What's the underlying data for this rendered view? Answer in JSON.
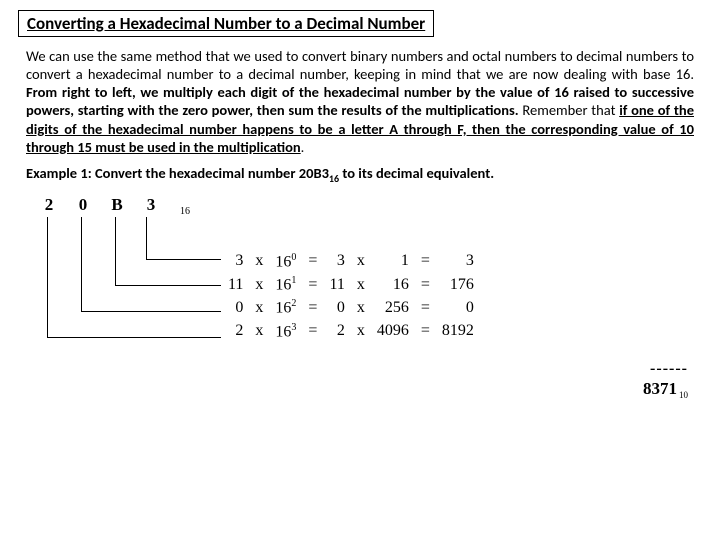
{
  "title": "Converting a Hexadecimal Number to a Decimal Number",
  "para": {
    "p1": "We can use the same method that we used to convert binary numbers and octal numbers to decimal numbers to convert a hexadecimal number to a decimal number, keeping in mind that we are now dealing with base 16. ",
    "p2": "From right to left, we multiply each digit of the hexadecimal number by the value of 16 raised to successive powers, starting with the zero power, then sum the results of the multiplications.",
    "p3": " Remember that ",
    "p4": "if one of the digits of the hexadecimal number happens to be a letter A through F, then the corresponding value of 10 through 15 must be used in the multiplication",
    "p5": "."
  },
  "example_label": "Example 1: Convert the hexadecimal number 20B3",
  "example_sub": "16",
  "example_tail": " to its decimal equivalent.",
  "hex": {
    "d0": "2",
    "d1": "0",
    "d2": "B",
    "d3": "3",
    "sub": "16"
  },
  "calc": {
    "rows": [
      {
        "v": "3",
        "p": "0",
        "a": "3",
        "b": "1",
        "r": "3"
      },
      {
        "v": "11",
        "p": "1",
        "a": "11",
        "b": "16",
        "r": "176"
      },
      {
        "v": "0",
        "p": "2",
        "a": "0",
        "b": "256",
        "r": "0"
      },
      {
        "v": "2",
        "p": "3",
        "a": "2",
        "b": "4096",
        "r": "8192"
      }
    ],
    "x": "x",
    "eq": "=",
    "base": "16"
  },
  "divider": "------",
  "answer": "8371",
  "answer_sub": "10"
}
